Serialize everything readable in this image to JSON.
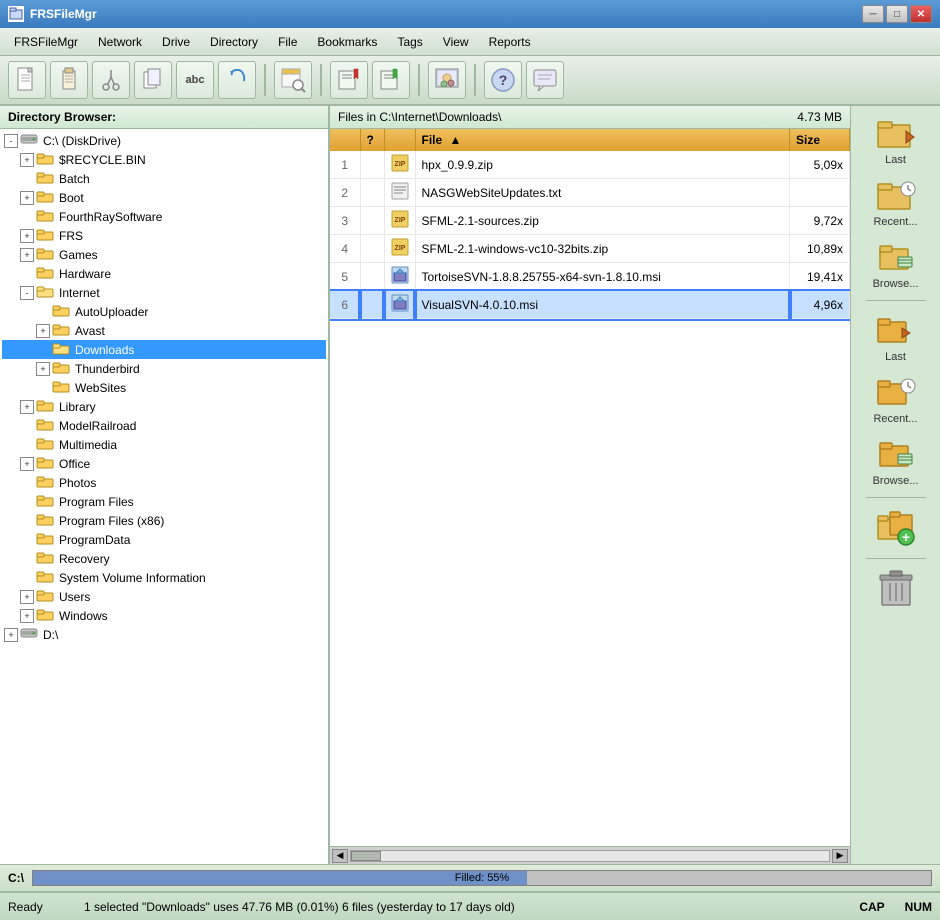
{
  "titlebar": {
    "title": "FRSFileMgr",
    "icon": "📁",
    "min_btn": "─",
    "max_btn": "□",
    "close_btn": "✕"
  },
  "menubar": {
    "items": [
      "FRSFileMgr",
      "Network",
      "Drive",
      "Directory",
      "File",
      "Bookmarks",
      "Tags",
      "View",
      "Reports"
    ]
  },
  "toolbar": {
    "buttons": [
      {
        "icon": "📄",
        "name": "new"
      },
      {
        "icon": "📋",
        "name": "clipboard"
      },
      {
        "icon": "✂",
        "name": "cut"
      },
      {
        "icon": "📋",
        "name": "copy"
      },
      {
        "icon": "abc",
        "name": "rename"
      },
      {
        "icon": "↩",
        "name": "undo"
      },
      {
        "icon": "🔍",
        "name": "find"
      },
      {
        "icon": "📌",
        "name": "bookmark1"
      },
      {
        "icon": "📌",
        "name": "bookmark2"
      },
      {
        "icon": "🖼",
        "name": "view"
      },
      {
        "icon": "❓",
        "name": "help"
      },
      {
        "icon": "💬",
        "name": "comment"
      }
    ]
  },
  "directory_browser": {
    "header": "Directory Browser:",
    "tree": [
      {
        "indent": 0,
        "expander": "-",
        "type": "drive",
        "label": "C:\\ (DiskDrive)",
        "expanded": true
      },
      {
        "indent": 1,
        "expander": "+",
        "type": "folder",
        "label": "$RECYCLE.BIN"
      },
      {
        "indent": 1,
        "expander": null,
        "type": "folder",
        "label": "Batch"
      },
      {
        "indent": 1,
        "expander": "+",
        "type": "folder",
        "label": "Boot"
      },
      {
        "indent": 1,
        "expander": null,
        "type": "folder",
        "label": "FourthRaySoftware"
      },
      {
        "indent": 1,
        "expander": "+",
        "type": "folder",
        "label": "FRS"
      },
      {
        "indent": 1,
        "expander": "+",
        "type": "folder",
        "label": "Games"
      },
      {
        "indent": 1,
        "expander": null,
        "type": "folder",
        "label": "Hardware"
      },
      {
        "indent": 1,
        "expander": "-",
        "type": "folder",
        "label": "Internet",
        "expanded": true
      },
      {
        "indent": 2,
        "expander": null,
        "type": "folder",
        "label": "AutoUploader"
      },
      {
        "indent": 2,
        "expander": "+",
        "type": "folder",
        "label": "Avast"
      },
      {
        "indent": 2,
        "expander": null,
        "type": "folder",
        "label": "Downloads",
        "selected": true
      },
      {
        "indent": 2,
        "expander": "+",
        "type": "folder",
        "label": "Thunderbird"
      },
      {
        "indent": 2,
        "expander": null,
        "type": "folder",
        "label": "WebSites"
      },
      {
        "indent": 1,
        "expander": "+",
        "type": "folder",
        "label": "Library"
      },
      {
        "indent": 1,
        "expander": null,
        "type": "folder",
        "label": "ModelRailroad"
      },
      {
        "indent": 1,
        "expander": null,
        "type": "folder",
        "label": "Multimedia"
      },
      {
        "indent": 1,
        "expander": "+",
        "type": "folder",
        "label": "Office"
      },
      {
        "indent": 1,
        "expander": null,
        "type": "folder",
        "label": "Photos"
      },
      {
        "indent": 1,
        "expander": null,
        "type": "folder",
        "label": "Program Files"
      },
      {
        "indent": 1,
        "expander": null,
        "type": "folder",
        "label": "Program Files (x86)"
      },
      {
        "indent": 1,
        "expander": null,
        "type": "folder",
        "label": "ProgramData"
      },
      {
        "indent": 1,
        "expander": null,
        "type": "folder",
        "label": "Recovery"
      },
      {
        "indent": 1,
        "expander": null,
        "type": "folder",
        "label": "System Volume Information"
      },
      {
        "indent": 1,
        "expander": "+",
        "type": "folder",
        "label": "Users"
      },
      {
        "indent": 1,
        "expander": "+",
        "type": "folder",
        "label": "Windows"
      },
      {
        "indent": 0,
        "expander": "+",
        "type": "drive",
        "label": "D:\\"
      }
    ]
  },
  "file_list": {
    "header_path": "Files in C:\\Internet\\Downloads\\",
    "header_size": "4.73 MB",
    "columns": [
      {
        "label": "",
        "key": "num"
      },
      {
        "label": "?",
        "key": "flag"
      },
      {
        "label": "",
        "key": "icon"
      },
      {
        "label": "File",
        "key": "name",
        "sort": "asc"
      },
      {
        "label": "Size",
        "key": "size"
      }
    ],
    "files": [
      {
        "num": 1,
        "flag": "",
        "icon": "zip",
        "name": "hpx_0.9.9.zip",
        "size": "5,09x",
        "selected": false
      },
      {
        "num": 2,
        "flag": "",
        "icon": "txt",
        "name": "NASGWebSiteUpdates.txt",
        "size": "",
        "selected": false
      },
      {
        "num": 3,
        "flag": "",
        "icon": "zip",
        "name": "SFML-2.1-sources.zip",
        "size": "9,72x",
        "selected": false
      },
      {
        "num": 4,
        "flag": "",
        "icon": "zip",
        "name": "SFML-2.1-windows-vc10-32bits.zip",
        "size": "10,89x",
        "selected": false
      },
      {
        "num": 5,
        "flag": "",
        "icon": "msi",
        "name": "TortoiseSVN-1.8.8.25755-x64-svn-1.8.10.msi",
        "size": "19,41x",
        "selected": false
      },
      {
        "num": 6,
        "flag": "",
        "icon": "msi",
        "name": "VisualSVN-4.0.10.msi",
        "size": "4,96x",
        "selected": true,
        "active": true
      }
    ]
  },
  "right_panel": {
    "sections": [
      {
        "buttons": [
          {
            "label": "Last",
            "icon": "folder_last"
          },
          {
            "label": "Recent...",
            "icon": "folder_recent"
          },
          {
            "label": "Browse...",
            "icon": "folder_browse"
          }
        ]
      },
      {
        "buttons": [
          {
            "label": "Last",
            "icon": "folder_last2"
          },
          {
            "label": "Recent...",
            "icon": "folder_recent2"
          },
          {
            "label": "Browse...",
            "icon": "folder_browse2"
          }
        ]
      },
      {
        "buttons": [
          {
            "label": "",
            "icon": "copy_green"
          }
        ]
      },
      {
        "buttons": [
          {
            "label": "",
            "icon": "trash"
          }
        ]
      }
    ]
  },
  "drive_bar": {
    "label": "C:\\",
    "fill_label": "Filled:",
    "fill_percent": 55,
    "fill_text": "55%"
  },
  "statusbar": {
    "ready": "Ready",
    "info": "1 selected   \"Downloads\" uses 47.76 MB (0.01%)   6 files (yesterday to 17 days old)",
    "caps": "CAP",
    "num": "NUM"
  }
}
